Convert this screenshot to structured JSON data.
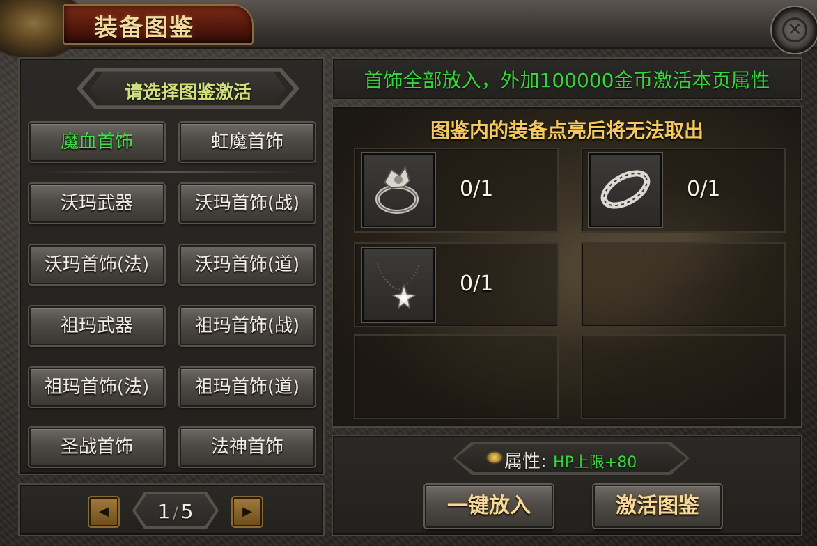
{
  "window": {
    "title": "装备图鉴"
  },
  "left": {
    "header": "请选择图鉴激活",
    "categories": [
      {
        "label": "魔血首饰",
        "active": true
      },
      {
        "label": "虹魔首饰",
        "active": false
      },
      {
        "label": "沃玛武器",
        "active": false
      },
      {
        "label": "沃玛首饰(战)",
        "active": false
      },
      {
        "label": "沃玛首饰(法)",
        "active": false
      },
      {
        "label": "沃玛首饰(道)",
        "active": false
      },
      {
        "label": "祖玛武器",
        "active": false
      },
      {
        "label": "祖玛首饰(战)",
        "active": false
      },
      {
        "label": "祖玛首饰(法)",
        "active": false
      },
      {
        "label": "祖玛首饰(道)",
        "active": false
      },
      {
        "label": "圣战首饰",
        "active": false
      },
      {
        "label": "法神首饰",
        "active": false
      }
    ],
    "pager": {
      "current": "1",
      "separator": "/",
      "total": "5",
      "prev_icon": "triangle-left-icon",
      "next_icon": "triangle-right-icon"
    }
  },
  "right": {
    "banner": "首饰全部放入，外加100000金币激活本页属性",
    "gallery_title": "图鉴内的装备点亮后将无法取出",
    "slots": [
      {
        "icon": "ring-icon",
        "count": "0/1"
      },
      {
        "icon": "bracelet-icon",
        "count": "0/1"
      },
      {
        "icon": "necklace-icon",
        "count": "0/1"
      }
    ],
    "attribute": {
      "icon": "eye-icon",
      "label": "属性:",
      "value": "HP上限+80"
    },
    "buttons": {
      "put_all": "一键放入",
      "activate": "激活图鉴"
    }
  },
  "colors": {
    "active_green": "#35d63c",
    "gold_text": "#f5c95c",
    "title_red": "#7a2a16"
  }
}
